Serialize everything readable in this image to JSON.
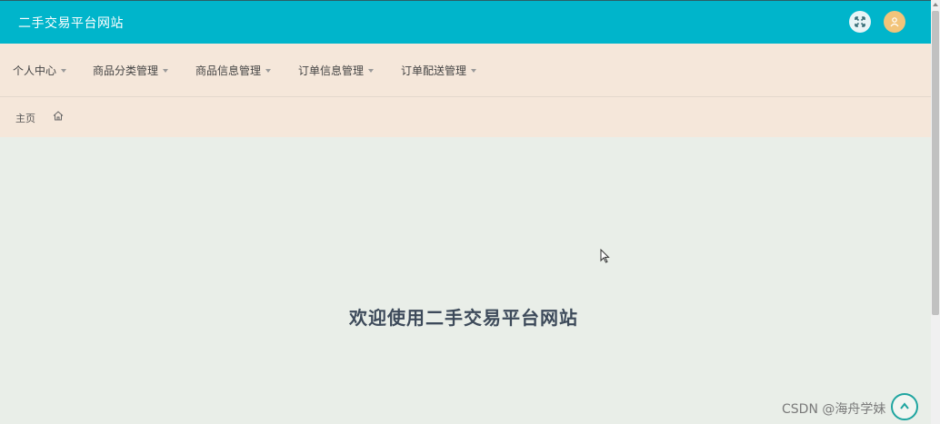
{
  "header": {
    "site_title": "二手交易平台网站",
    "fullscreen_icon": "expand-arrows-icon",
    "avatar_icon": "user-icon"
  },
  "nav": {
    "items": [
      {
        "label": "个人中心"
      },
      {
        "label": "商品分类管理"
      },
      {
        "label": "商品信息管理"
      },
      {
        "label": "订单信息管理"
      },
      {
        "label": "订单配送管理"
      }
    ]
  },
  "breadcrumb": {
    "home_label": "主页",
    "home_icon": "home-icon"
  },
  "main": {
    "welcome": "欢迎使用二手交易平台网站"
  },
  "watermark": "CSDN @海舟学妹",
  "colors": {
    "header_bg": "#00b5cb",
    "nav_bg": "#f5e7da",
    "page_bg": "#e9eee8",
    "avatar_bg": "#f2c47a",
    "welcome_text": "#3d4a5a"
  }
}
